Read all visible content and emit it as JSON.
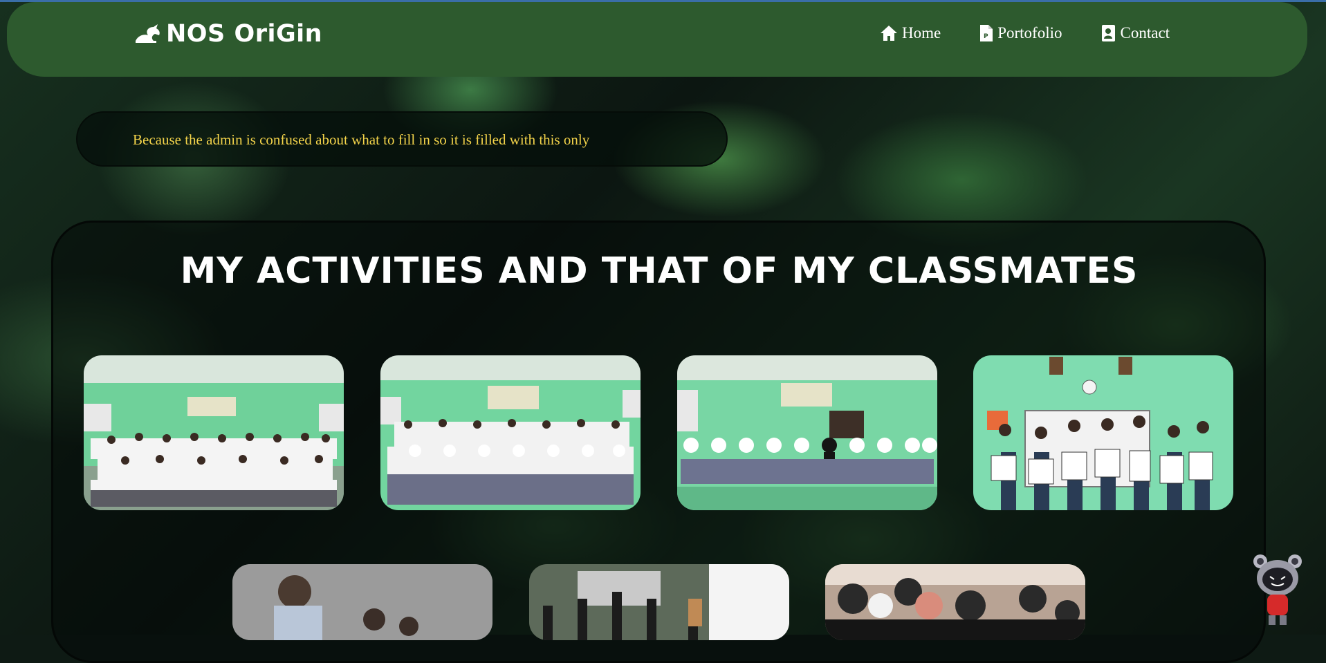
{
  "brand": {
    "name": "NOS OriGin",
    "logo_icon": "dragon-logo-icon"
  },
  "nav": [
    {
      "label": "Home",
      "icon": "home-icon"
    },
    {
      "label": "Portofolio",
      "icon": "document-icon"
    },
    {
      "label": "Contact",
      "icon": "contact-card-icon"
    }
  ],
  "notice": {
    "text": "Because the admin is confused about what to fill in so it is filled with this only"
  },
  "gallery": {
    "title": "MY ACTIVITIES AND THAT OF MY CLASSMATES",
    "photos": [
      {
        "name": "class-photo-boys"
      },
      {
        "name": "class-photo-full"
      },
      {
        "name": "class-photo-girls"
      },
      {
        "name": "students-holding-drawings"
      },
      {
        "name": "student-writing"
      },
      {
        "name": "outdoor-activity"
      },
      {
        "name": "group-with-helmets"
      }
    ]
  },
  "colors": {
    "navbar": "#2d5a2e",
    "notice_text": "#f3d34a",
    "title": "#ffffff"
  },
  "mascot": {
    "icon": "robot-mascot-icon"
  }
}
